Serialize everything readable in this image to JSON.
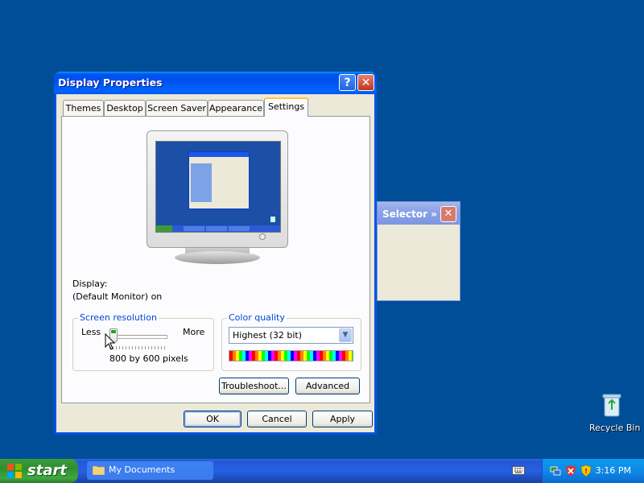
{
  "background_window": {
    "title": "Selector »",
    "close": "✕"
  },
  "dialog": {
    "title": "Display Properties",
    "help": "?",
    "close": "✕",
    "tabs": [
      "Themes",
      "Desktop",
      "Screen Saver",
      "Appearance",
      "Settings"
    ],
    "active_tab": "Settings",
    "display_label": "Display:",
    "display_value": "(Default Monitor) on",
    "resolution": {
      "legend": "Screen resolution",
      "less": "Less",
      "more": "More",
      "value": "800 by 600 pixels",
      "slider_position": 0
    },
    "color": {
      "legend": "Color quality",
      "selected": "Highest (32 bit)"
    },
    "buttons": {
      "troubleshoot": "Troubleshoot...",
      "advanced": "Advanced",
      "ok": "OK",
      "cancel": "Cancel",
      "apply": "Apply"
    }
  },
  "desktop": {
    "recycle_bin": "Recycle Bin"
  },
  "taskbar": {
    "start": "start",
    "items": [
      "My Documents"
    ],
    "clock": "3:16 PM"
  },
  "colors": {
    "desktop": "#004e98",
    "titlebar": "#0054e3",
    "start": "#3c9a3c",
    "legend": "#0046d5"
  }
}
